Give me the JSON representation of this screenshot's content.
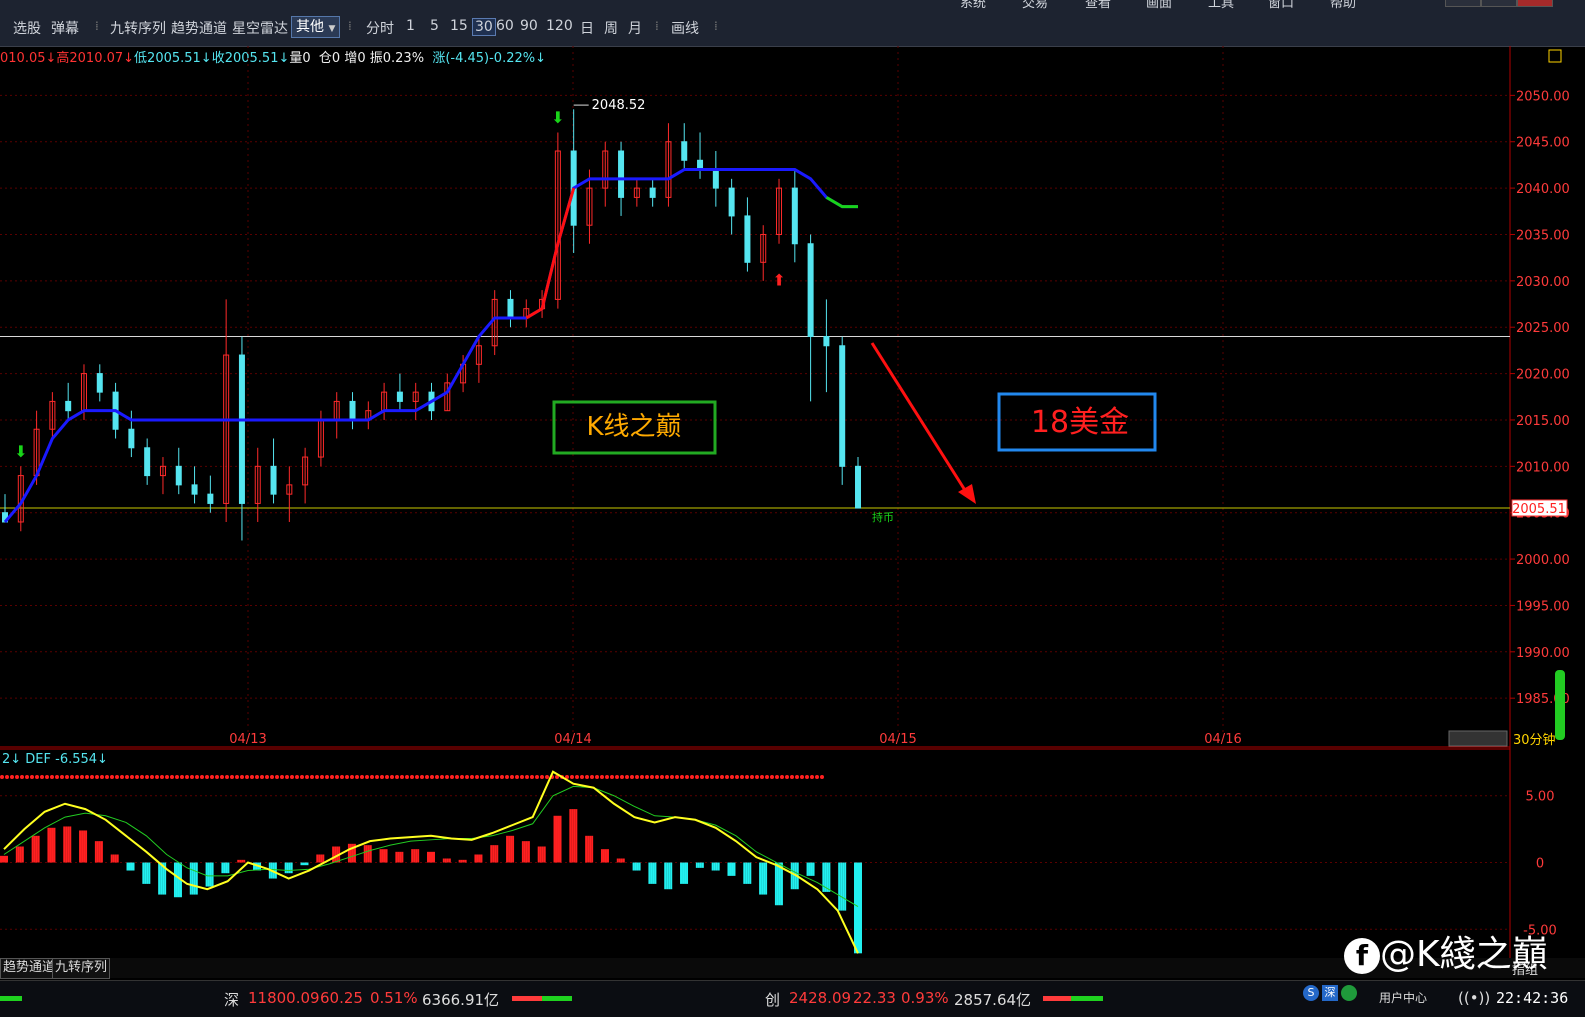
{
  "menu": [
    "系统",
    "交易",
    "查看",
    "画面",
    "工具",
    "窗口",
    "帮助"
  ],
  "toolbar": {
    "items": [
      "选股",
      "弹幕",
      "九转序列",
      "趋势通道",
      "星空雷达"
    ],
    "select_value": "其他",
    "periods": [
      "分时",
      "1",
      "5",
      "15",
      "30",
      "60",
      "90",
      "120",
      "日",
      "周",
      "月"
    ],
    "active_period": "30",
    "draw_label": "画线"
  },
  "infobar": {
    "open": "010.05↓",
    "high": "高2010.07↓",
    "low": "低2005.51↓",
    "close": "收2005.51↓",
    "volume": "量0",
    "position": "仓0",
    "increase": "增0",
    "amplitude": "振0.23%",
    "change": "涨(-4.45)-0.22%↓"
  },
  "chart_data": {
    "type": "candlestick",
    "period": "30分钟",
    "ylim": [
      1982,
      2055
    ],
    "ticks": [
      "2050.00",
      "2045.00",
      "2040.00",
      "2035.00",
      "2030.00",
      "2025.00",
      "2020.00",
      "2015.00",
      "2010.00",
      "2005.00",
      "2000.00",
      "1995.00",
      "1990.00",
      "1985.00"
    ],
    "tick_values": [
      2050,
      2045,
      2040,
      2035,
      2030,
      2025,
      2020,
      2015,
      2010,
      2005,
      2000,
      1995,
      1990,
      1985
    ],
    "x_labels": [
      "04/13",
      "04/14",
      "04/15",
      "04/16"
    ],
    "high_label": "2048.52",
    "current_price_label": "2005.51",
    "hline_level": 2024,
    "hold_label": "持币",
    "annotations": [
      "K线之巅",
      "18美金"
    ],
    "candles": [
      [
        2005,
        2007,
        2004,
        2004
      ],
      [
        2004,
        2010,
        2003,
        2009
      ],
      [
        2009,
        2016,
        2008,
        2014
      ],
      [
        2014,
        2018,
        2013,
        2017
      ],
      [
        2017,
        2019,
        2015,
        2016
      ],
      [
        2016,
        2021,
        2015,
        2020
      ],
      [
        2020,
        2021,
        2017,
        2018
      ],
      [
        2018,
        2019,
        2013,
        2014
      ],
      [
        2014,
        2016,
        2011,
        2012
      ],
      [
        2012,
        2013,
        2008,
        2009
      ],
      [
        2009,
        2011,
        2007,
        2010
      ],
      [
        2010,
        2012,
        2007,
        2008
      ],
      [
        2008,
        2010,
        2006,
        2007
      ],
      [
        2007,
        2009,
        2005,
        2006
      ],
      [
        2006,
        2028,
        2004,
        2022
      ],
      [
        2022,
        2024,
        2002,
        2006
      ],
      [
        2006,
        2012,
        2004,
        2010
      ],
      [
        2010,
        2013,
        2006,
        2007
      ],
      [
        2007,
        2010,
        2004,
        2008
      ],
      [
        2008,
        2012,
        2006,
        2011
      ],
      [
        2011,
        2016,
        2010,
        2015
      ],
      [
        2015,
        2018,
        2013,
        2017
      ],
      [
        2017,
        2018,
        2014,
        2015
      ],
      [
        2015,
        2017,
        2014,
        2016
      ],
      [
        2016,
        2019,
        2015,
        2018
      ],
      [
        2018,
        2020,
        2016,
        2017
      ],
      [
        2017,
        2019,
        2015,
        2018
      ],
      [
        2018,
        2019,
        2015,
        2016
      ],
      [
        2016,
        2020,
        2016,
        2019
      ],
      [
        2019,
        2022,
        2018,
        2021
      ],
      [
        2021,
        2024,
        2019,
        2023
      ],
      [
        2023,
        2029,
        2022,
        2028
      ],
      [
        2028,
        2029,
        2025,
        2026
      ],
      [
        2026,
        2028,
        2025,
        2027
      ],
      [
        2027,
        2029,
        2026,
        2028
      ],
      [
        2028,
        2046,
        2027,
        2044
      ],
      [
        2044,
        2048.5,
        2033,
        2036
      ],
      [
        2036,
        2042,
        2034,
        2040
      ],
      [
        2040,
        2045,
        2038,
        2044
      ],
      [
        2044,
        2045,
        2037,
        2039
      ],
      [
        2039,
        2041,
        2038,
        2040
      ],
      [
        2040,
        2041,
        2038,
        2039
      ],
      [
        2039,
        2047,
        2038,
        2045
      ],
      [
        2045,
        2047,
        2042,
        2043
      ],
      [
        2043,
        2046,
        2041,
        2042
      ],
      [
        2042,
        2044,
        2038,
        2040
      ],
      [
        2040,
        2041,
        2035,
        2037
      ],
      [
        2037,
        2039,
        2031,
        2032
      ],
      [
        2032,
        2036,
        2030,
        2035
      ],
      [
        2035,
        2041,
        2034,
        2040
      ],
      [
        2040,
        2042,
        2032,
        2034
      ],
      [
        2034,
        2035,
        2017,
        2024
      ],
      [
        2024,
        2028,
        2018,
        2023
      ],
      [
        2023,
        2024,
        2008,
        2010
      ],
      [
        2010,
        2011,
        2005.5,
        2005.5
      ]
    ],
    "ma": [
      2004,
      2006,
      2009,
      2013,
      2015,
      2016,
      2016,
      2016,
      2015,
      2015,
      2015,
      2015,
      2015,
      2015,
      2015,
      2015,
      2015,
      2015,
      2015,
      2015,
      2015,
      2015,
      2015,
      2015,
      2016,
      2016,
      2016,
      2017,
      2018,
      2021,
      2024,
      2026,
      2026,
      2026,
      2027,
      2034,
      2040,
      2041,
      2041,
      2041,
      2041,
      2041,
      2041,
      2042,
      2042,
      2042,
      2042,
      2042,
      2042,
      2042,
      2042,
      2041,
      2039,
      2038,
      2038
    ],
    "macd_label": "2↓  DEF -6.554↓",
    "macd_ticks": [
      "5.00",
      "0",
      "-5.00"
    ],
    "macd_tick_values": [
      5,
      0,
      -5
    ],
    "macd_ylim": [
      -7,
      8.5
    ],
    "macd_hist": [
      0.5,
      1.2,
      2.0,
      2.6,
      2.7,
      2.4,
      1.6,
      0.6,
      -0.6,
      -1.6,
      -2.4,
      -2.6,
      -2.4,
      -1.8,
      -0.8,
      0.2,
      -0.6,
      -1.2,
      -0.8,
      -0.2,
      0.6,
      1.2,
      1.4,
      1.3,
      1.0,
      0.8,
      1.0,
      0.8,
      0.3,
      0.2,
      0.6,
      1.3,
      2.0,
      1.6,
      1.2,
      3.5,
      4.0,
      2.0,
      1.0,
      0.3,
      -0.6,
      -1.6,
      -2.0,
      -1.6,
      -0.4,
      -0.6,
      -1.0,
      -1.6,
      -2.4,
      -3.2,
      -2.0,
      -1.0,
      -2.2,
      -3.6,
      -6.8
    ],
    "macd_dif": [
      1.0,
      2.5,
      3.8,
      4.4,
      4.0,
      3.2,
      2.0,
      0.8,
      -0.5,
      -1.6,
      -2.0,
      -1.4,
      0.0,
      -0.5,
      -1.2,
      -0.6,
      0.2,
      1.0,
      1.6,
      1.8,
      1.9,
      2.0,
      1.8,
      1.7,
      2.2,
      2.8,
      3.4,
      6.8,
      5.9,
      5.6,
      4.4,
      3.4,
      3.0,
      3.4,
      3.2,
      2.6,
      1.6,
      0.4,
      -0.2,
      -1.0,
      -2.0,
      -3.6,
      -6.8
    ],
    "macd_dea": [
      0.6,
      1.6,
      2.6,
      3.4,
      3.7,
      3.5,
      3.0,
      2.0,
      0.6,
      -0.4,
      -1.0,
      -1.0,
      -0.6,
      -0.5,
      -0.6,
      -0.5,
      -0.1,
      0.4,
      0.9,
      1.3,
      1.6,
      1.7,
      1.8,
      1.8,
      2.0,
      2.4,
      2.9,
      5.0,
      5.7,
      5.6,
      5.0,
      4.2,
      3.5,
      3.4,
      3.2,
      2.8,
      2.0,
      0.8,
      0.0,
      -0.8,
      -1.5,
      -2.4,
      -3.3
    ]
  },
  "tabs": [
    "趋势通道",
    "九转序列"
  ],
  "bottom_right": "指组",
  "statusbar": {
    "sz_label": "深",
    "sz_index": "11800.09",
    "sz_change": "60.25",
    "sz_pct": "0.51%",
    "sz_amount": "6366.91亿",
    "cy_label": "创",
    "cy_index": "2428.09",
    "cy_change": "22.33",
    "cy_pct": "0.93%",
    "cy_amount": "2857.64亿",
    "user_center": "用户中心",
    "time": "22:42:36"
  },
  "watermark": "@K綫之巔",
  "colors": {
    "up": "#ff2a2a",
    "down": "#55e5f0",
    "ma": "#1a1aff",
    "grid": "#5a0000",
    "axis": "#b00000"
  }
}
